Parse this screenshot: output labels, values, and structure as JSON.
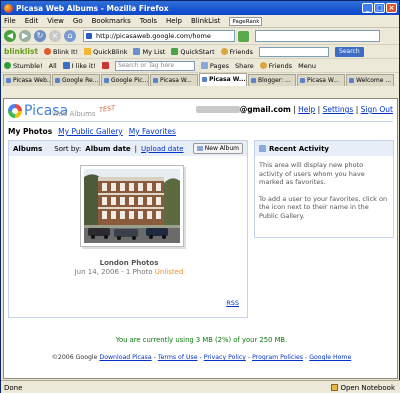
{
  "window": {
    "title": "Picasa Web Albums - Mozilla Firefox"
  },
  "menu": [
    "File",
    "Edit",
    "View",
    "Go",
    "Bookmarks",
    "Tools",
    "Help",
    "BlinkList"
  ],
  "pagerank_label": "PageRank",
  "address": {
    "url": "http://picasaweb.google.com/home"
  },
  "toolbar": {
    "blinklist": "blinklist",
    "blink_it": "Blink It!",
    "quickblink": "QuickBlink",
    "my_list": "My List",
    "quickstart": "QuickStart",
    "friends": "Friends",
    "search_button": "Search"
  },
  "stumble": {
    "stumble": "Stumble!",
    "all": "All",
    "i_like_it": "I like it!",
    "search_placeholder": "Search or Tag here",
    "pages": "Pages",
    "share": "Share",
    "friends": "Friends",
    "menu": "Menu"
  },
  "tabs": [
    "Picasa Web...",
    "Google Re...",
    "Google Pic...",
    "Picasa W...",
    "Picasa W...",
    "Blogger: ...",
    "Picasa W...",
    "Welcome ..."
  ],
  "header": {
    "logo": "Picasa",
    "logo_sub": "Web Albums",
    "logo_test": "TEST",
    "email_domain": "@gmail.com",
    "sep": "|",
    "help": "Help",
    "settings": "Settings",
    "sign_out": "Sign Out"
  },
  "subnav": {
    "my_photos": "My Photos",
    "public_gallery": "My Public Gallery",
    "favorites": "My Favorites"
  },
  "albums": {
    "label": "Albums",
    "sort_by": "Sort by:",
    "sort_current": "Album date",
    "sep": "|",
    "sort_alt": "Upload date",
    "new_album": "New Album",
    "album": {
      "title": "London Photos",
      "meta": "Jun 14, 2006 - 1 Photo",
      "status": "Unlisted"
    },
    "rss": "RSS"
  },
  "recent": {
    "title": "Recent Activity",
    "p1": "This area will display new photo activity of users whom you have marked as favorites.",
    "p2": "To add a user to your favorites, click on the icon next to their name in the Public Gallery."
  },
  "usage": "You are currently using 3 MB (2%) of your 250 MB.",
  "footer": {
    "copyright": "©2006 Google",
    "download": "Download Picasa",
    "terms": "Terms of Use",
    "privacy": "Privacy Policy",
    "program": "Program Policies",
    "home": "Google Home",
    "dash": "-"
  },
  "status": {
    "left": "Done",
    "notebook": "Open Notebook"
  },
  "colors": {
    "title_bar": "#0b46c9",
    "link": "#0033cc",
    "usage_green": "#0a7a0a",
    "unlisted": "#e8902c"
  }
}
